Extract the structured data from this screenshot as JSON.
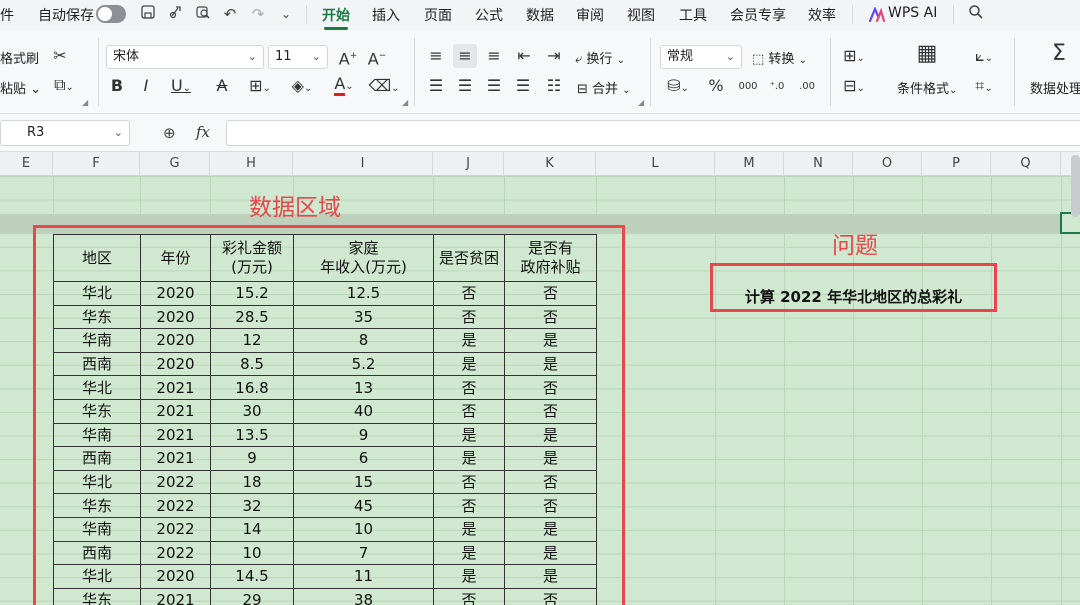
{
  "menu": {
    "file_partial": "件",
    "autosave_label": "自动保存",
    "tabs": [
      "开始",
      "插入",
      "页面",
      "公式",
      "数据",
      "审阅",
      "视图",
      "工具",
      "会员专享",
      "效率"
    ],
    "active_tab": "开始",
    "wps_ai_label": "WPS AI"
  },
  "ribbon": {
    "format_painter_label": "格式刷",
    "paste_label": "粘贴",
    "font_name": "宋体",
    "font_size": "11",
    "wrap_label": "换行",
    "merge_label": "合并",
    "number_format": "常规",
    "convert_label": "转换",
    "conditional_format_label": "条件格式",
    "data_process_label": "数据处理",
    "font_color": "#e02020"
  },
  "formula_bar": {
    "cell_ref": "R3",
    "fx_label": "fx",
    "formula_value": ""
  },
  "columns": [
    "E",
    "F",
    "G",
    "H",
    "I",
    "J",
    "K",
    "L",
    "M",
    "N",
    "O",
    "P",
    "Q"
  ],
  "annotations": {
    "data_area_title": "数据区域",
    "question_title": "问题",
    "question_text": "计算 2022 年华北地区的总彩礼"
  },
  "table": {
    "headers": [
      [
        "地区"
      ],
      [
        "年份"
      ],
      [
        "彩礼金额",
        "(万元)"
      ],
      [
        "家庭",
        "年收入(万元)"
      ],
      [
        "是否贫困"
      ],
      [
        "是否有",
        "政府补贴"
      ]
    ],
    "rows": [
      [
        "华北",
        "2020",
        "15.2",
        "12.5",
        "否",
        "否"
      ],
      [
        "华东",
        "2020",
        "28.5",
        "35",
        "否",
        "否"
      ],
      [
        "华南",
        "2020",
        "12",
        "8",
        "是",
        "是"
      ],
      [
        "西南",
        "2020",
        "8.5",
        "5.2",
        "是",
        "是"
      ],
      [
        "华北",
        "2021",
        "16.8",
        "13",
        "否",
        "否"
      ],
      [
        "华东",
        "2021",
        "30",
        "40",
        "否",
        "否"
      ],
      [
        "华南",
        "2021",
        "13.5",
        "9",
        "是",
        "是"
      ],
      [
        "西南",
        "2021",
        "9",
        "6",
        "是",
        "是"
      ],
      [
        "华北",
        "2022",
        "18",
        "15",
        "否",
        "否"
      ],
      [
        "华东",
        "2022",
        "32",
        "45",
        "否",
        "否"
      ],
      [
        "华南",
        "2022",
        "14",
        "10",
        "是",
        "是"
      ],
      [
        "西南",
        "2022",
        "10",
        "7",
        "是",
        "是"
      ],
      [
        "华北",
        "2020",
        "14.5",
        "11",
        "是",
        "是"
      ],
      [
        "华东",
        "2021",
        "29",
        "38",
        "否",
        "否"
      ]
    ]
  },
  "colors": {
    "accent": "#1c7a45",
    "annotation_red": "#e8474b",
    "sheet_green": "#cfe8cf"
  }
}
